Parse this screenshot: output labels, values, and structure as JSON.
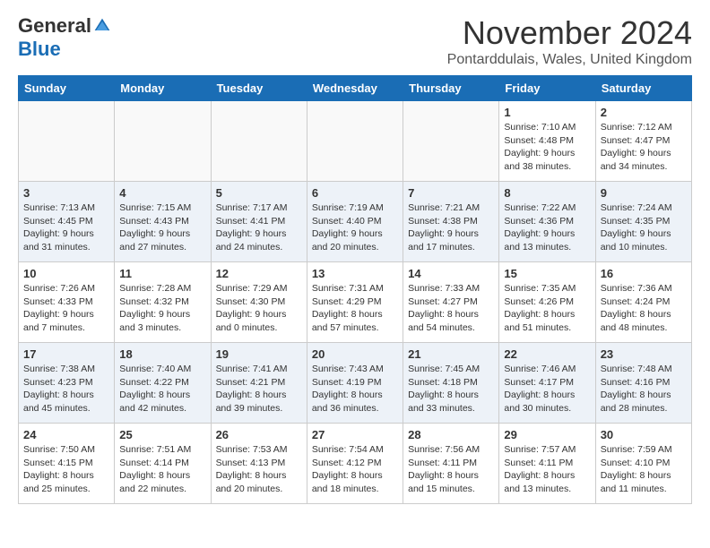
{
  "header": {
    "logo_general": "General",
    "logo_blue": "Blue",
    "month": "November 2024",
    "location": "Pontarddulais, Wales, United Kingdom"
  },
  "days_of_week": [
    "Sunday",
    "Monday",
    "Tuesday",
    "Wednesday",
    "Thursday",
    "Friday",
    "Saturday"
  ],
  "weeks": [
    [
      {
        "day": "",
        "info": ""
      },
      {
        "day": "",
        "info": ""
      },
      {
        "day": "",
        "info": ""
      },
      {
        "day": "",
        "info": ""
      },
      {
        "day": "",
        "info": ""
      },
      {
        "day": "1",
        "info": "Sunrise: 7:10 AM\nSunset: 4:48 PM\nDaylight: 9 hours\nand 38 minutes."
      },
      {
        "day": "2",
        "info": "Sunrise: 7:12 AM\nSunset: 4:47 PM\nDaylight: 9 hours\nand 34 minutes."
      }
    ],
    [
      {
        "day": "3",
        "info": "Sunrise: 7:13 AM\nSunset: 4:45 PM\nDaylight: 9 hours\nand 31 minutes."
      },
      {
        "day": "4",
        "info": "Sunrise: 7:15 AM\nSunset: 4:43 PM\nDaylight: 9 hours\nand 27 minutes."
      },
      {
        "day": "5",
        "info": "Sunrise: 7:17 AM\nSunset: 4:41 PM\nDaylight: 9 hours\nand 24 minutes."
      },
      {
        "day": "6",
        "info": "Sunrise: 7:19 AM\nSunset: 4:40 PM\nDaylight: 9 hours\nand 20 minutes."
      },
      {
        "day": "7",
        "info": "Sunrise: 7:21 AM\nSunset: 4:38 PM\nDaylight: 9 hours\nand 17 minutes."
      },
      {
        "day": "8",
        "info": "Sunrise: 7:22 AM\nSunset: 4:36 PM\nDaylight: 9 hours\nand 13 minutes."
      },
      {
        "day": "9",
        "info": "Sunrise: 7:24 AM\nSunset: 4:35 PM\nDaylight: 9 hours\nand 10 minutes."
      }
    ],
    [
      {
        "day": "10",
        "info": "Sunrise: 7:26 AM\nSunset: 4:33 PM\nDaylight: 9 hours\nand 7 minutes."
      },
      {
        "day": "11",
        "info": "Sunrise: 7:28 AM\nSunset: 4:32 PM\nDaylight: 9 hours\nand 3 minutes."
      },
      {
        "day": "12",
        "info": "Sunrise: 7:29 AM\nSunset: 4:30 PM\nDaylight: 9 hours\nand 0 minutes."
      },
      {
        "day": "13",
        "info": "Sunrise: 7:31 AM\nSunset: 4:29 PM\nDaylight: 8 hours\nand 57 minutes."
      },
      {
        "day": "14",
        "info": "Sunrise: 7:33 AM\nSunset: 4:27 PM\nDaylight: 8 hours\nand 54 minutes."
      },
      {
        "day": "15",
        "info": "Sunrise: 7:35 AM\nSunset: 4:26 PM\nDaylight: 8 hours\nand 51 minutes."
      },
      {
        "day": "16",
        "info": "Sunrise: 7:36 AM\nSunset: 4:24 PM\nDaylight: 8 hours\nand 48 minutes."
      }
    ],
    [
      {
        "day": "17",
        "info": "Sunrise: 7:38 AM\nSunset: 4:23 PM\nDaylight: 8 hours\nand 45 minutes."
      },
      {
        "day": "18",
        "info": "Sunrise: 7:40 AM\nSunset: 4:22 PM\nDaylight: 8 hours\nand 42 minutes."
      },
      {
        "day": "19",
        "info": "Sunrise: 7:41 AM\nSunset: 4:21 PM\nDaylight: 8 hours\nand 39 minutes."
      },
      {
        "day": "20",
        "info": "Sunrise: 7:43 AM\nSunset: 4:19 PM\nDaylight: 8 hours\nand 36 minutes."
      },
      {
        "day": "21",
        "info": "Sunrise: 7:45 AM\nSunset: 4:18 PM\nDaylight: 8 hours\nand 33 minutes."
      },
      {
        "day": "22",
        "info": "Sunrise: 7:46 AM\nSunset: 4:17 PM\nDaylight: 8 hours\nand 30 minutes."
      },
      {
        "day": "23",
        "info": "Sunrise: 7:48 AM\nSunset: 4:16 PM\nDaylight: 8 hours\nand 28 minutes."
      }
    ],
    [
      {
        "day": "24",
        "info": "Sunrise: 7:50 AM\nSunset: 4:15 PM\nDaylight: 8 hours\nand 25 minutes."
      },
      {
        "day": "25",
        "info": "Sunrise: 7:51 AM\nSunset: 4:14 PM\nDaylight: 8 hours\nand 22 minutes."
      },
      {
        "day": "26",
        "info": "Sunrise: 7:53 AM\nSunset: 4:13 PM\nDaylight: 8 hours\nand 20 minutes."
      },
      {
        "day": "27",
        "info": "Sunrise: 7:54 AM\nSunset: 4:12 PM\nDaylight: 8 hours\nand 18 minutes."
      },
      {
        "day": "28",
        "info": "Sunrise: 7:56 AM\nSunset: 4:11 PM\nDaylight: 8 hours\nand 15 minutes."
      },
      {
        "day": "29",
        "info": "Sunrise: 7:57 AM\nSunset: 4:11 PM\nDaylight: 8 hours\nand 13 minutes."
      },
      {
        "day": "30",
        "info": "Sunrise: 7:59 AM\nSunset: 4:10 PM\nDaylight: 8 hours\nand 11 minutes."
      }
    ]
  ]
}
